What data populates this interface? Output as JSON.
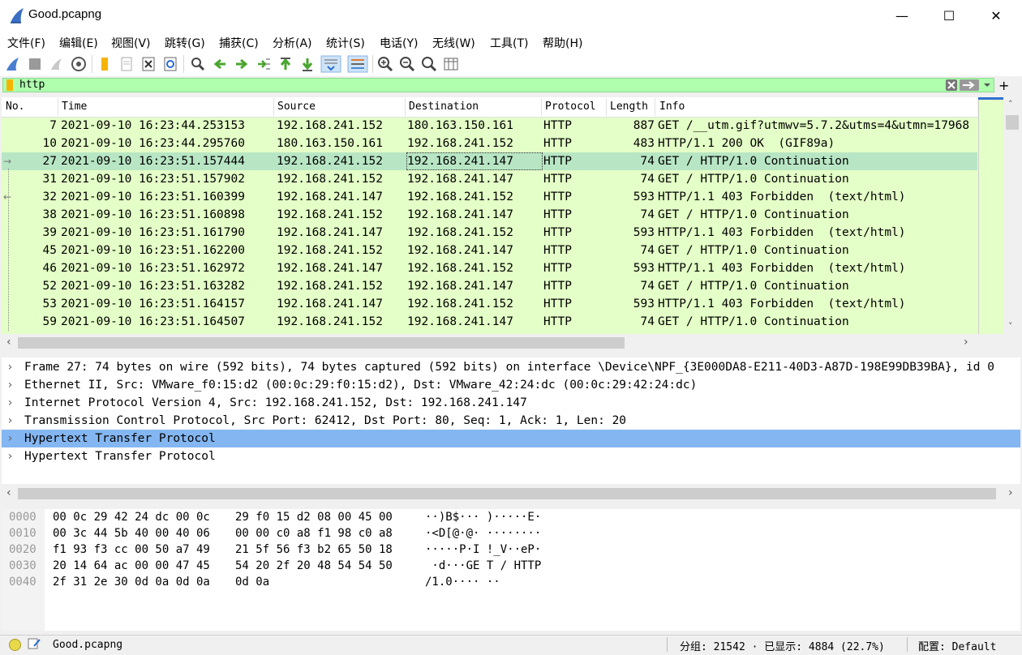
{
  "window": {
    "title": "Good.pcapng"
  },
  "menu": [
    "文件(F)",
    "编辑(E)",
    "视图(V)",
    "跳转(G)",
    "捕获(C)",
    "分析(A)",
    "统计(S)",
    "电话(Y)",
    "无线(W)",
    "工具(T)",
    "帮助(H)"
  ],
  "filter": {
    "value": "http"
  },
  "packet_list": {
    "columns": [
      "No.",
      "Time",
      "Source",
      "Destination",
      "Protocol",
      "Length",
      "Info"
    ],
    "rows": [
      {
        "no": "7",
        "time": "2021-09-10 16:23:44.253153",
        "src": "192.168.241.152",
        "dst": "180.163.150.161",
        "proto": "HTTP",
        "len": "887",
        "info": "GET /__utm.gif?utmwv=5.7.2&utms=4&utmn=17968"
      },
      {
        "no": "10",
        "time": "2021-09-10 16:23:44.295760",
        "src": "180.163.150.161",
        "dst": "192.168.241.152",
        "proto": "HTTP",
        "len": "483",
        "info": "HTTP/1.1 200 OK  (GIF89a)"
      },
      {
        "no": "27",
        "time": "2021-09-10 16:23:51.157444",
        "src": "192.168.241.152",
        "dst": "192.168.241.147",
        "proto": "HTTP",
        "len": "74",
        "info": "GET / HTTP/1.0 Continuation"
      },
      {
        "no": "31",
        "time": "2021-09-10 16:23:51.157902",
        "src": "192.168.241.152",
        "dst": "192.168.241.147",
        "proto": "HTTP",
        "len": "74",
        "info": "GET / HTTP/1.0 Continuation"
      },
      {
        "no": "32",
        "time": "2021-09-10 16:23:51.160399",
        "src": "192.168.241.147",
        "dst": "192.168.241.152",
        "proto": "HTTP",
        "len": "593",
        "info": "HTTP/1.1 403 Forbidden  (text/html)"
      },
      {
        "no": "38",
        "time": "2021-09-10 16:23:51.160898",
        "src": "192.168.241.152",
        "dst": "192.168.241.147",
        "proto": "HTTP",
        "len": "74",
        "info": "GET / HTTP/1.0 Continuation"
      },
      {
        "no": "39",
        "time": "2021-09-10 16:23:51.161790",
        "src": "192.168.241.147",
        "dst": "192.168.241.152",
        "proto": "HTTP",
        "len": "593",
        "info": "HTTP/1.1 403 Forbidden  (text/html)"
      },
      {
        "no": "45",
        "time": "2021-09-10 16:23:51.162200",
        "src": "192.168.241.152",
        "dst": "192.168.241.147",
        "proto": "HTTP",
        "len": "74",
        "info": "GET / HTTP/1.0 Continuation"
      },
      {
        "no": "46",
        "time": "2021-09-10 16:23:51.162972",
        "src": "192.168.241.147",
        "dst": "192.168.241.152",
        "proto": "HTTP",
        "len": "593",
        "info": "HTTP/1.1 403 Forbidden  (text/html)"
      },
      {
        "no": "52",
        "time": "2021-09-10 16:23:51.163282",
        "src": "192.168.241.152",
        "dst": "192.168.241.147",
        "proto": "HTTP",
        "len": "74",
        "info": "GET / HTTP/1.0 Continuation"
      },
      {
        "no": "53",
        "time": "2021-09-10 16:23:51.164157",
        "src": "192.168.241.147",
        "dst": "192.168.241.152",
        "proto": "HTTP",
        "len": "593",
        "info": "HTTP/1.1 403 Forbidden  (text/html)"
      },
      {
        "no": "59",
        "time": "2021-09-10 16:23:51.164507",
        "src": "192.168.241.152",
        "dst": "192.168.241.147",
        "proto": "HTTP",
        "len": "74",
        "info": "GET / HTTP/1.0 Continuation"
      }
    ],
    "selected_no": "27"
  },
  "details": [
    "Frame 27: 74 bytes on wire (592 bits), 74 bytes captured (592 bits) on interface \\Device\\NPF_{3E000DA8-E211-40D3-A87D-198E99DB39BA}, id 0",
    "Ethernet II, Src: VMware_f0:15:d2 (00:0c:29:f0:15:d2), Dst: VMware_42:24:dc (00:0c:29:42:24:dc)",
    "Internet Protocol Version 4, Src: 192.168.241.152, Dst: 192.168.241.147",
    "Transmission Control Protocol, Src Port: 62412, Dst Port: 80, Seq: 1, Ack: 1, Len: 20",
    "Hypertext Transfer Protocol",
    "Hypertext Transfer Protocol"
  ],
  "selected_detail": 4,
  "bytes": [
    {
      "offset": "0000",
      "hex1": "00 0c 29 42 24 dc 00 0c",
      "hex2": "29 f0 15 d2 08 00 45 00",
      "ascii": "··)B$··· )·····E·"
    },
    {
      "offset": "0010",
      "hex1": "00 3c 44 5b 40 00 40 06",
      "hex2": "00 00 c0 a8 f1 98 c0 a8",
      "ascii": "·<D[@·@· ········"
    },
    {
      "offset": "0020",
      "hex1": "f1 93 f3 cc 00 50 a7 49",
      "hex2": "21 5f 56 f3 b2 65 50 18",
      "ascii": "·····P·I !_V··eP·"
    },
    {
      "offset": "0030",
      "hex1": "20 14 64 ac 00 00 47 45",
      "hex2": "54 20 2f 20 48 54 54 50",
      "ascii": " ·d···GE T / HTTP"
    },
    {
      "offset": "0040",
      "hex1": "2f 31 2e 30 0d 0a 0d 0a",
      "hex2": "0d 0a",
      "ascii": "/1.0···· ··"
    }
  ],
  "status": {
    "file": "Good.pcapng",
    "packets": "分组: 21542 · 已显示: 4884 (22.7%)",
    "profile": "配置: Default"
  },
  "colors": {
    "packet_bg": "#e4ffc7",
    "selected_row": "#b8e6c4",
    "filter_bg": "#afffaf",
    "detail_selected": "#84b6f1"
  }
}
